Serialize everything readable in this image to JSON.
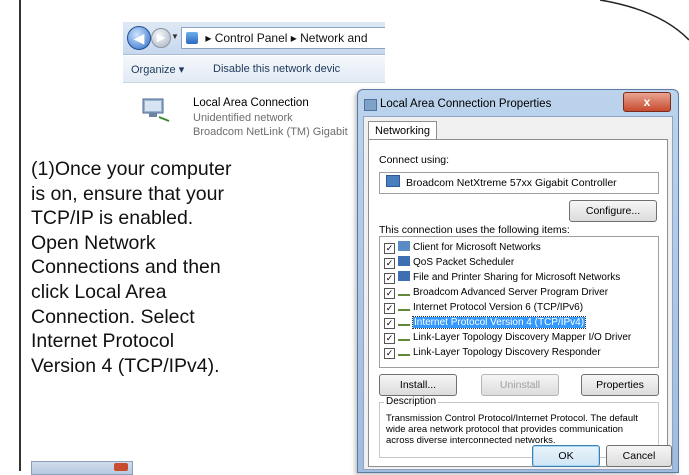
{
  "explorer": {
    "address_parts": [
      "Control Panel",
      "Network and"
    ],
    "toolbar": {
      "organize": "Organize ▾",
      "disable": "Disable this network devic"
    },
    "connection": {
      "name": "Local Area Connection",
      "status": "Unidentified network",
      "adapter": "Broadcom NetLink (TM) Gigabit"
    }
  },
  "instructions": "(1)Once your computer\nis on, ensure that your\nTCP/IP is enabled.\nOpen Network\nConnections and then\nclick Local Area\nConnection. Select\nInternet Protocol\nVersion 4 (TCP/IPv4).",
  "dialog": {
    "title": "Local Area Connection Properties",
    "close_label": "x",
    "tab": "Networking",
    "connect_using_label": "Connect using:",
    "adapter": "Broadcom NetXtreme 57xx Gigabit Controller",
    "configure_label": "Configure...",
    "items_label": "This connection uses the following items:",
    "items": [
      {
        "label": "Client for Microsoft Networks",
        "checked": true
      },
      {
        "label": "QoS Packet Scheduler",
        "checked": true
      },
      {
        "label": "File and Printer Sharing for Microsoft Networks",
        "checked": true
      },
      {
        "label": "Broadcom Advanced Server Program Driver",
        "checked": true
      },
      {
        "label": "Internet Protocol Version 6 (TCP/IPv6)",
        "checked": true
      },
      {
        "label": "Internet Protocol Version 4 (TCP/IPv4)",
        "checked": true,
        "selected": true
      },
      {
        "label": "Link-Layer Topology Discovery Mapper I/O Driver",
        "checked": true
      },
      {
        "label": "Link-Layer Topology Discovery Responder",
        "checked": true
      }
    ],
    "install_label": "Install...",
    "uninstall_label": "Uninstall",
    "properties_label": "Properties",
    "description_label": "Description",
    "description_text": "Transmission Control Protocol/Internet Protocol. The default wide area network protocol that provides communication across diverse interconnected networks.",
    "ok_label": "OK",
    "cancel_label": "Cancel"
  }
}
